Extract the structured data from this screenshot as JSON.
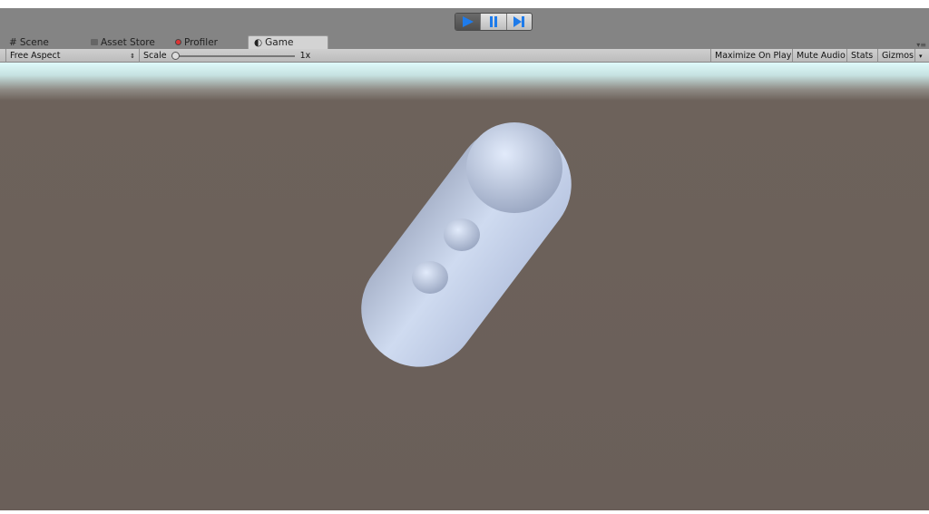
{
  "playbar": {
    "play_icon": "play-icon",
    "pause_icon": "pause-icon",
    "step_icon": "step-icon",
    "accent": "#1e7bea"
  },
  "tabs": [
    {
      "label": "Scene",
      "icon": "grid-icon"
    },
    {
      "label": "Asset Store",
      "icon": "store-bag-icon"
    },
    {
      "label": "Profiler",
      "icon": "profiler-icon"
    },
    {
      "label": "Game",
      "icon": "game-pacman-icon",
      "active": true
    }
  ],
  "gamebar": {
    "aspect": "Free Aspect",
    "scale_label": "Scale",
    "scale_value": "1x",
    "scale_fraction": 0,
    "maximize": "Maximize On Play",
    "mute": "Mute Audio",
    "stats": "Stats",
    "gizmos": "Gizmos"
  },
  "scene": {
    "ground_color": "#6a5f59",
    "sky_color": "#dffafa",
    "object_color": "#c9d6ec"
  }
}
